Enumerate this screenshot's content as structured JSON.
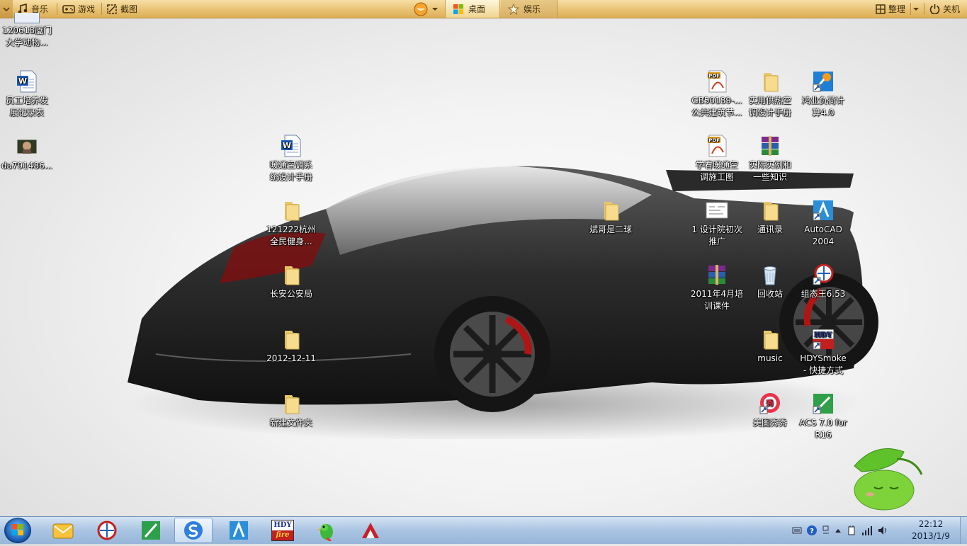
{
  "topbar": {
    "music_label": "音乐",
    "games_label": "游戏",
    "screenshot_label": "截图",
    "desktop_tab": "桌面",
    "entertainment_tab": "娱乐",
    "organize_label": "整理",
    "shutdown_label": "关机"
  },
  "desktop_icons": {
    "i01": {
      "l1": "120618厦门",
      "l2": "大学动物..."
    },
    "i02": {
      "l1": "员工培养发",
      "l2": "展记录表"
    },
    "i03": {
      "l1": "da791486...",
      "l2": ""
    },
    "i04": {
      "l1": "暖通空调系",
      "l2": "统设计手册"
    },
    "i05": {
      "l1": "121222杭州",
      "l2": "全民健身..."
    },
    "i06": {
      "l1": "长安公安局",
      "l2": ""
    },
    "i07": {
      "l1": "2012-12-11",
      "l2": ""
    },
    "i08": {
      "l1": "新建文件夹",
      "l2": ""
    },
    "i09": {
      "l1": "斌哥是二球",
      "l2": ""
    },
    "i10": {
      "l1": "GB50189-...",
      "l2": "公共建筑节..."
    },
    "i11": {
      "l1": "实用供热空",
      "l2": "调设计手册"
    },
    "i12": {
      "l1": "鸿业负荷计",
      "l2": "算4.0"
    },
    "i13": {
      "l1": "学看暖通空",
      "l2": "调施工图"
    },
    "i14": {
      "l1": "实际实例和",
      "l2": "一些知识"
    },
    "i15": {
      "l1": "1 设计院初次",
      "l2": "推广"
    },
    "i16": {
      "l1": "通讯录",
      "l2": ""
    },
    "i17": {
      "l1": "AutoCAD",
      "l2": "2004"
    },
    "i18": {
      "l1": "2011年4月培",
      "l2": "训课件"
    },
    "i19": {
      "l1": "回收站",
      "l2": ""
    },
    "i20": {
      "l1": "组态王6.53",
      "l2": ""
    },
    "i21": {
      "l1": "music",
      "l2": ""
    },
    "i22": {
      "l1": "HDYSmoke",
      "l2": "- 快捷方式"
    },
    "i23": {
      "l1": "美图秀秀",
      "l2": ""
    },
    "i24": {
      "l1": "ACS 7.0 for",
      "l2": "R16"
    }
  },
  "taskbar": {
    "time": "22:12",
    "date": "2013/1/9",
    "hdy_text_top": "HDY",
    "hdy_text_bottom": "fire"
  }
}
